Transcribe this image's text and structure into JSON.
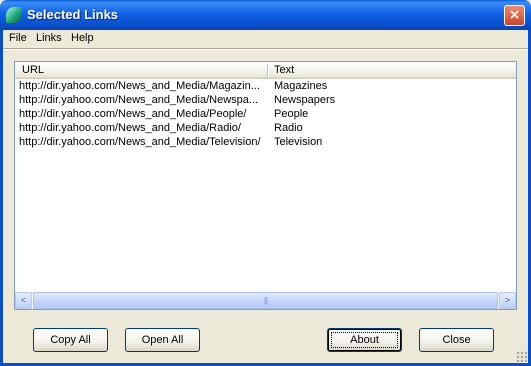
{
  "window": {
    "title": "Selected Links"
  },
  "menu": {
    "items": [
      "File",
      "Links",
      "Help"
    ]
  },
  "list": {
    "columns": [
      "URL",
      "Text"
    ],
    "rows": [
      {
        "url": "http://dir.yahoo.com/News_and_Media/Magazin...",
        "text": "Magazines"
      },
      {
        "url": "http://dir.yahoo.com/News_and_Media/Newspa...",
        "text": "Newspapers"
      },
      {
        "url": "http://dir.yahoo.com/News_and_Media/People/",
        "text": "People"
      },
      {
        "url": "http://dir.yahoo.com/News_and_Media/Radio/",
        "text": "Radio"
      },
      {
        "url": "http://dir.yahoo.com/News_and_Media/Television/",
        "text": "Television"
      }
    ]
  },
  "buttons": {
    "copy_all": "Copy All",
    "open_all": "Open All",
    "about": "About",
    "close": "Close"
  },
  "icons": {
    "close": "×",
    "scroll_left": "<",
    "scroll_right": ">",
    "thumb_grip": "|||"
  },
  "colors": {
    "titlebar": "#0a5fd8",
    "face": "#ece9d8",
    "close_button": "#c9452b"
  }
}
